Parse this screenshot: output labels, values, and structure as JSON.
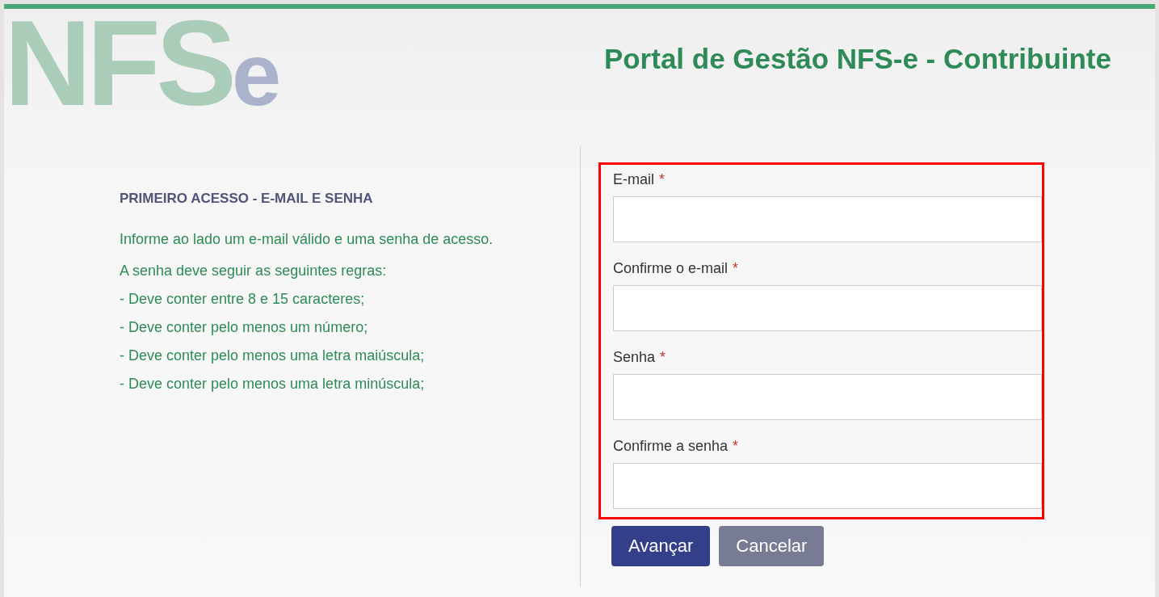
{
  "logo": {
    "letters": "NFS",
    "suffix": "e"
  },
  "title": "Portal de Gestão NFS-e - Contribuinte",
  "info": {
    "heading": "PRIMEIRO ACESSO - E-MAIL E SENHA",
    "intro": "Informe ao lado um e-mail válido e uma senha de acesso.",
    "rules_title": "A senha deve seguir as seguintes regras:",
    "rules": [
      "- Deve conter entre 8 e 15 caracteres;",
      "- Deve conter pelo menos um número;",
      "- Deve conter pelo menos uma letra maiúscula;",
      "- Deve conter pelo menos uma letra minúscula;"
    ]
  },
  "form": {
    "highlighted": true,
    "fields": [
      {
        "label": "E-mail",
        "required_mark": "*"
      },
      {
        "label": "Confirme o e-mail",
        "required_mark": "*"
      },
      {
        "label": "Senha",
        "required_mark": "*"
      },
      {
        "label": "Confirme a senha",
        "required_mark": "*"
      }
    ],
    "buttons": [
      {
        "label": "Avançar",
        "kind": "primary"
      },
      {
        "label": "Cancelar",
        "kind": "secondary"
      }
    ]
  }
}
